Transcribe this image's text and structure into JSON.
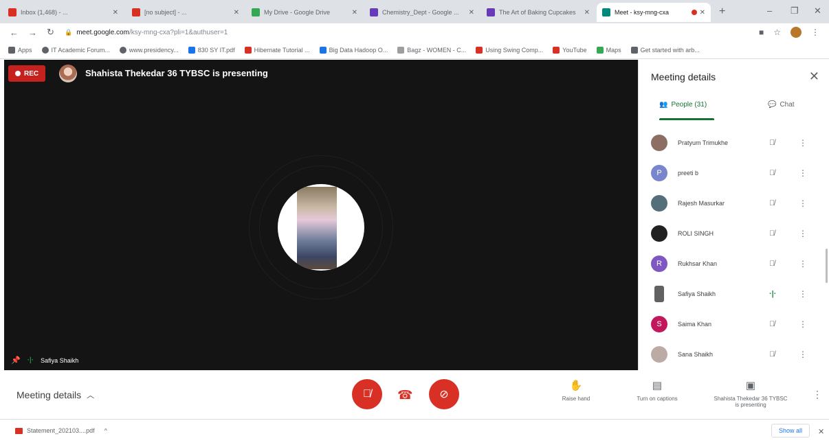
{
  "browser": {
    "tabs": [
      {
        "label": "Inbox (1,468) - ...",
        "favicon_color": "#d93025"
      },
      {
        "label": "[no subject] - ...",
        "favicon_color": "#d93025"
      },
      {
        "label": "My Drive - Google Drive",
        "favicon_color": "#34a853"
      },
      {
        "label": "Chemistry_Dept - Google ...",
        "favicon_color": "#673ab7"
      },
      {
        "label": "The Art of Baking Cupcakes",
        "favicon_color": "#673ab7"
      },
      {
        "label": "Meet - ksy-mng-cxa",
        "favicon_color": "#00897b"
      }
    ],
    "new_tab": "+",
    "url_host": "meet.google.com",
    "url_path": "/ksy-mng-cxa?pli=1&authuser=1",
    "bookmarks": [
      {
        "label": "Apps",
        "color": "#5f6368"
      },
      {
        "label": "IT Academic Forum...",
        "color": "#5f6368"
      },
      {
        "label": "www.presidency...",
        "color": "#5f6368"
      },
      {
        "label": "830 SY IT.pdf",
        "color": "#1a73e8"
      },
      {
        "label": "Hibernate Tutorial ...",
        "color": "#d93025"
      },
      {
        "label": "Big Data Hadoop O...",
        "color": "#1a73e8"
      },
      {
        "label": "Bagz - WOMEN - C...",
        "color": "#9e9e9e"
      },
      {
        "label": "Using Swing Comp...",
        "color": "#d93025"
      },
      {
        "label": "YouTube",
        "color": "#d93025"
      },
      {
        "label": "Maps",
        "color": "#34a853"
      },
      {
        "label": "Get started with arb...",
        "color": "#5f6368"
      }
    ]
  },
  "stage": {
    "rec_label": "REC",
    "presenter_text": "Shahista Thekedar 36 TYBSC is presenting",
    "bottom_name": "Safiya Shaikh"
  },
  "panel": {
    "title": "Meeting details",
    "people_tab": "People (31)",
    "chat_tab": "Chat",
    "participants": [
      {
        "name": "Pratyum Trimukhe",
        "initial": "",
        "color": "#8d6e63",
        "speaking": false
      },
      {
        "name": "preeti b",
        "initial": "P",
        "color": "#7986cb",
        "speaking": false
      },
      {
        "name": "Rajesh Masurkar",
        "initial": "",
        "color": "#546e7a",
        "speaking": false
      },
      {
        "name": "ROLI SINGH",
        "initial": "",
        "color": "#212121",
        "speaking": false
      },
      {
        "name": "Rukhsar Khan",
        "initial": "R",
        "color": "#7e57c2",
        "speaking": false
      },
      {
        "name": "Safiya Shaikh",
        "initial": "",
        "color": "#616161",
        "speaking": true
      },
      {
        "name": "Saima Khan",
        "initial": "S",
        "color": "#c2185b",
        "speaking": false
      },
      {
        "name": "Sana Shaikh",
        "initial": "",
        "color": "#bcaaa4",
        "speaking": false
      }
    ]
  },
  "bottom": {
    "meeting_details": "Meeting details",
    "raise_hand": "Raise hand",
    "captions": "Turn on captions",
    "presenting_line1": "Shahista Thekedar 36 TYBSC",
    "presenting_line2": "is presenting"
  },
  "downloads": {
    "file": "Statement_202103....pdf",
    "show_all": "Show all"
  }
}
